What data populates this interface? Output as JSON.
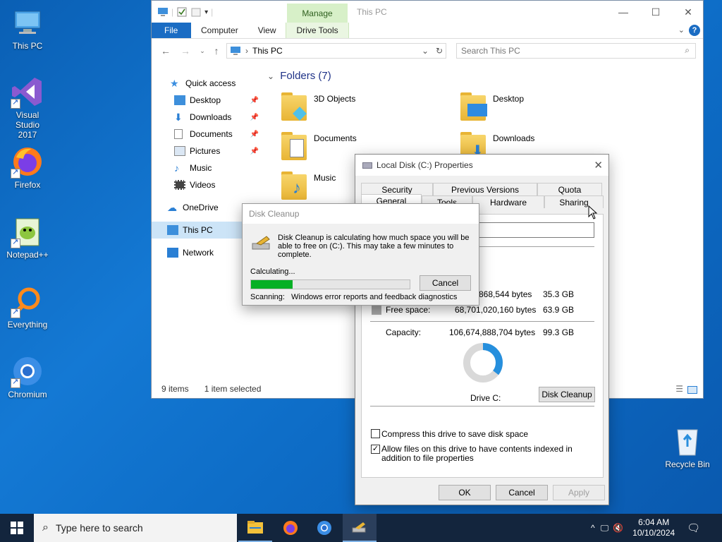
{
  "desktop": {
    "icons": [
      {
        "label": "This PC"
      },
      {
        "label": "Visual Studio 2017"
      },
      {
        "label": "Firefox"
      },
      {
        "label": "Notepad++"
      },
      {
        "label": "Everything"
      },
      {
        "label": "Chromium"
      },
      {
        "label": "Recycle Bin"
      }
    ]
  },
  "explorer": {
    "title": "This PC",
    "manage_label": "Manage",
    "tabs": [
      "File",
      "Computer",
      "View",
      "Drive Tools"
    ],
    "address": "This PC",
    "search_placeholder": "Search This PC",
    "nav": {
      "quick_access": "Quick access",
      "items": [
        "Desktop",
        "Downloads",
        "Documents",
        "Pictures",
        "Music",
        "Videos"
      ],
      "onedrive": "OneDrive",
      "this_pc": "This PC",
      "network": "Network"
    },
    "folders_header": "Folders (7)",
    "folders": [
      "3D Objects",
      "Desktop",
      "Documents",
      "Downloads",
      "Music"
    ],
    "status": {
      "items": "9 items",
      "selected": "1 item selected"
    }
  },
  "properties": {
    "title": "Local Disk (C:) Properties",
    "tabs_top": [
      "Security",
      "Previous Versions",
      "Quota"
    ],
    "tabs_bottom": [
      "General",
      "Tools",
      "Hardware",
      "Sharing"
    ],
    "used_bytes": "868,544 bytes",
    "used_size": "35.3 GB",
    "free_label": "Free space:",
    "free_bytes": "68,701,020,160 bytes",
    "free_size": "63.9 GB",
    "capacity_label": "Capacity:",
    "capacity_bytes": "106,674,888,704 bytes",
    "capacity_size": "99.3 GB",
    "drive_label": "Drive C:",
    "disk_cleanup_btn": "Disk Cleanup",
    "compress_label": "Compress this drive to save disk space",
    "compress_checked": false,
    "index_label": "Allow files on this drive to have contents indexed in addition to file properties",
    "index_checked": true,
    "ok": "OK",
    "cancel": "Cancel",
    "apply": "Apply",
    "used_fraction": 0.355
  },
  "cleanup": {
    "title": "Disk Cleanup",
    "message": "Disk Cleanup is calculating how much space you will be able to free on  (C:). This may take a few minutes to complete.",
    "calculating": "Calculating...",
    "cancel": "Cancel",
    "scanning_label": "Scanning:",
    "scanning_item": "Windows error reports and feedback diagnostics",
    "progress": 0.26
  },
  "taskbar": {
    "search_placeholder": "Type here to search",
    "time": "6:04 AM",
    "date": "10/10/2024"
  },
  "colors": {
    "accent": "#1a6cc3",
    "progress": "#06b025",
    "used": "#268fdd",
    "free": "#d9d9d9"
  }
}
